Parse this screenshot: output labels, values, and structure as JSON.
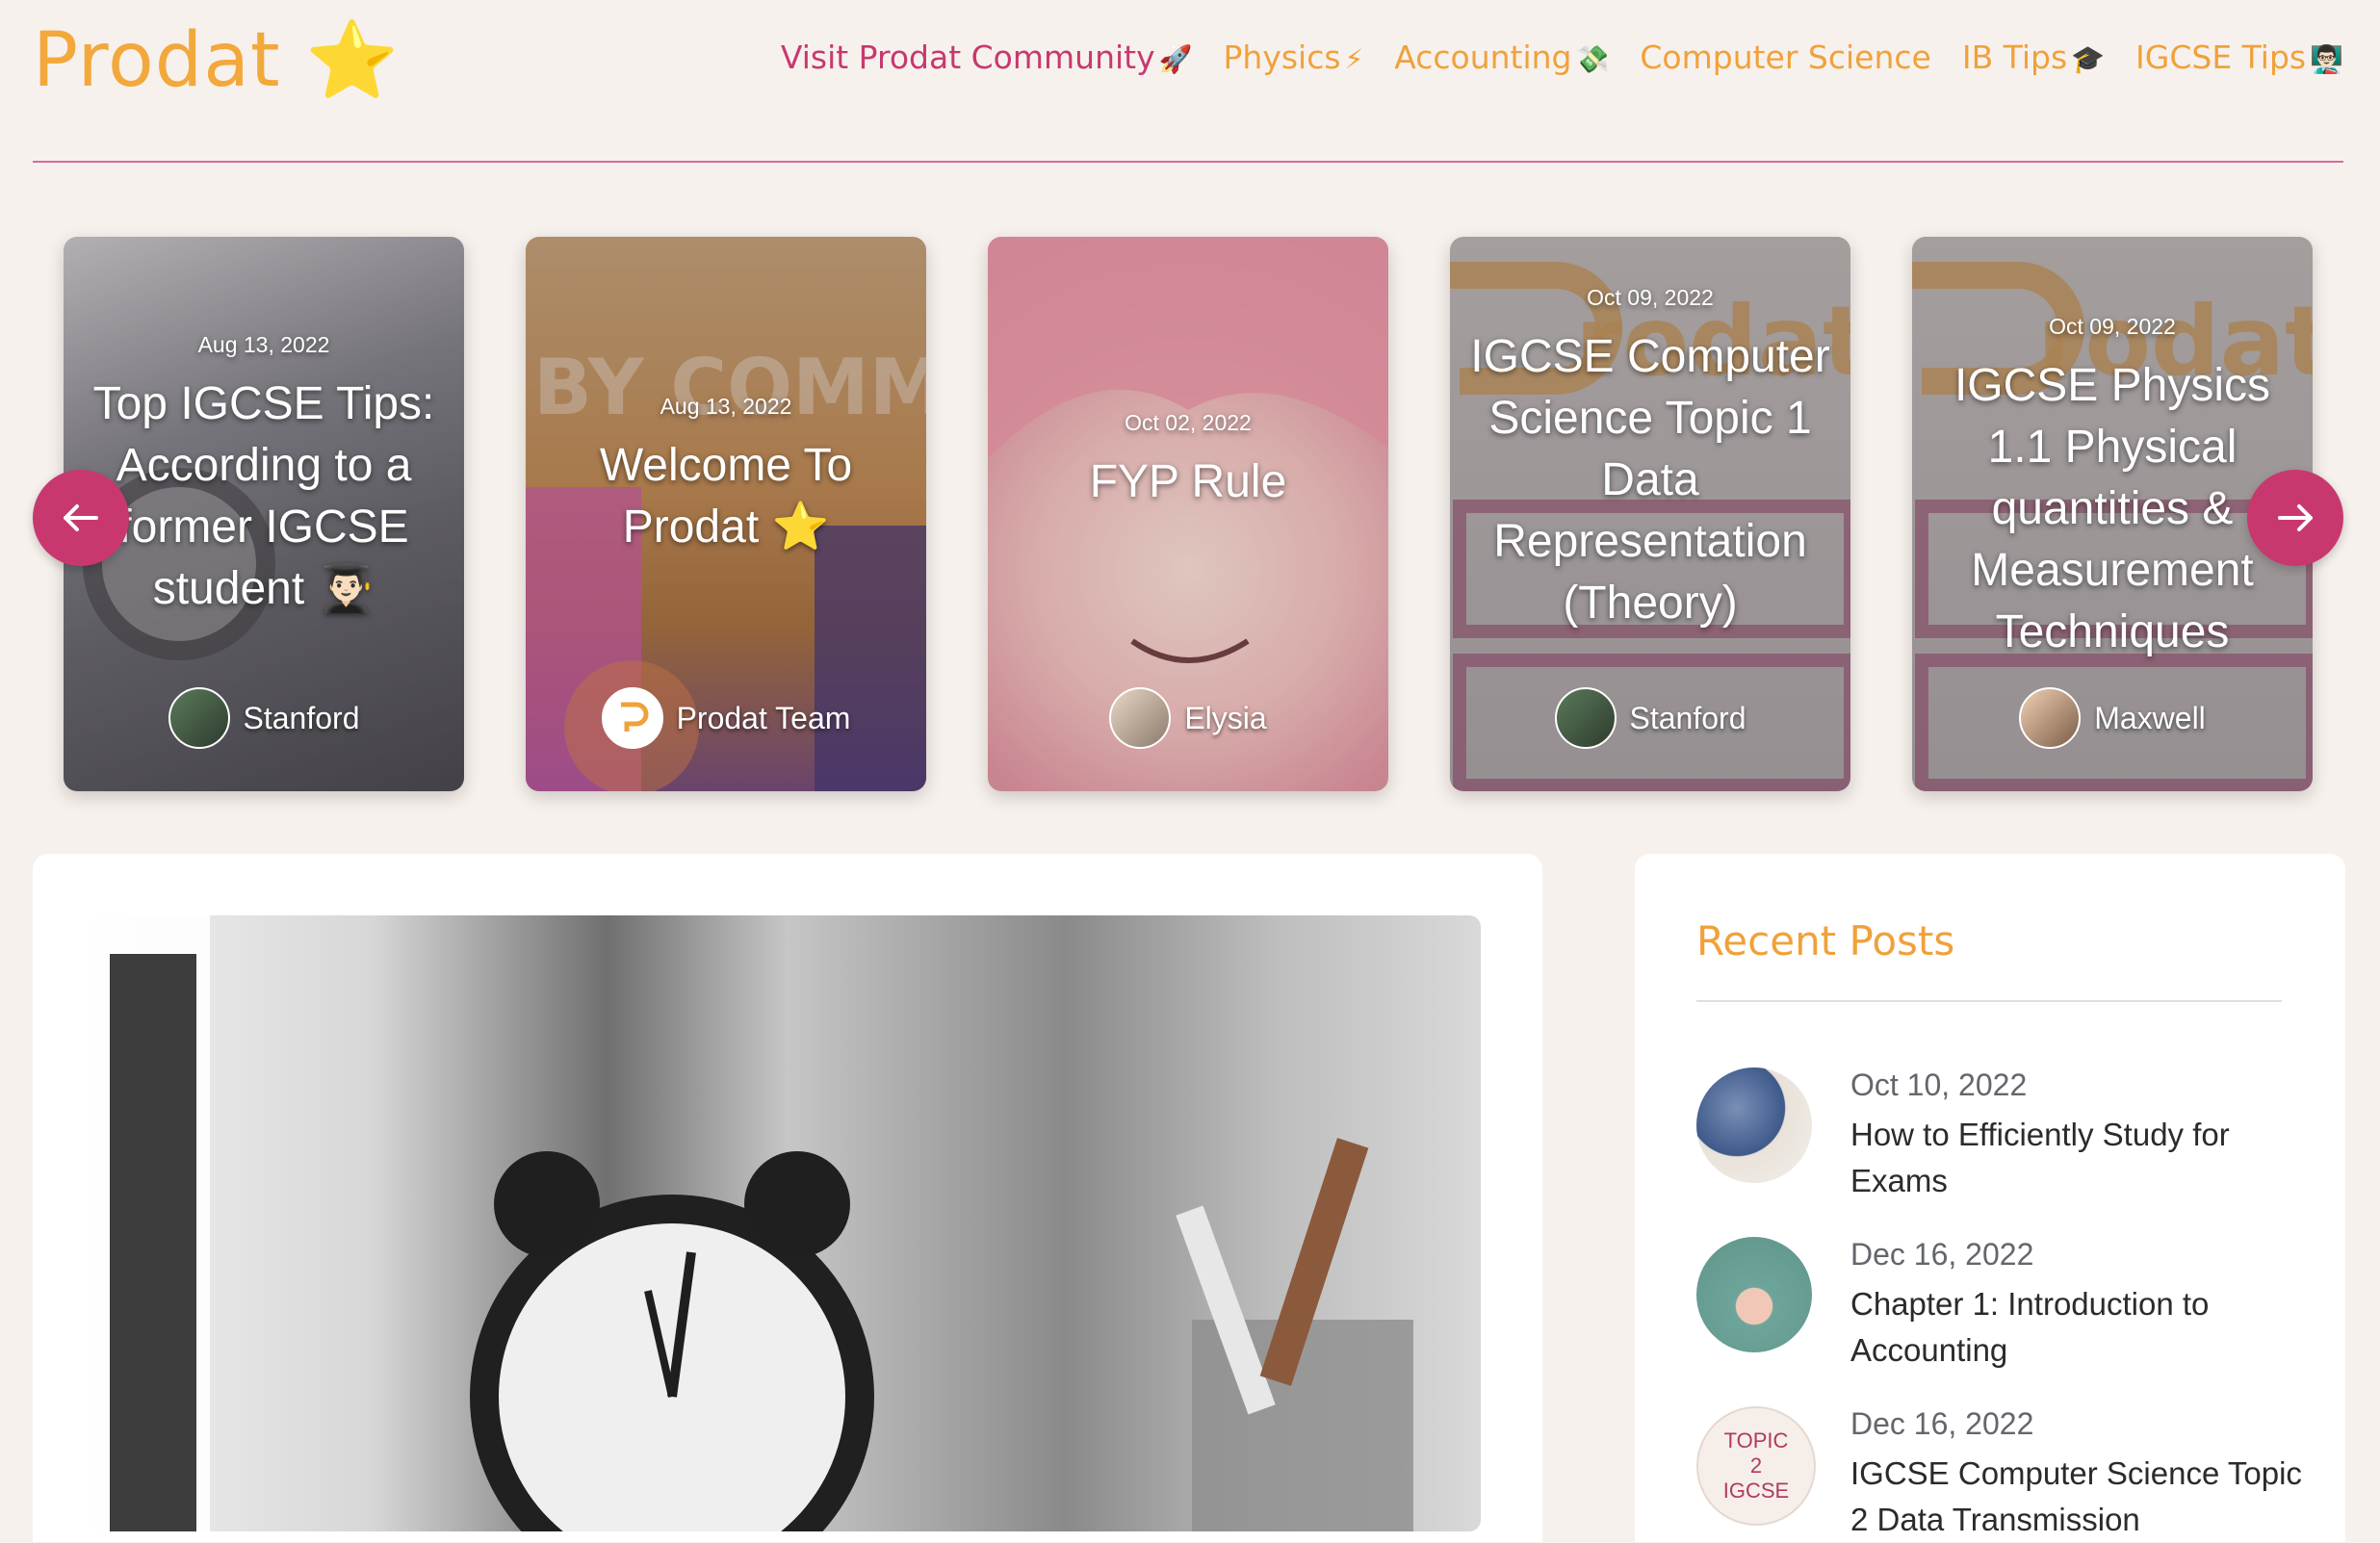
{
  "header": {
    "logo": "Prodat ⭐",
    "nav": [
      {
        "label": "Visit Prodat Community",
        "emoji": "🚀"
      },
      {
        "label": "Physics",
        "emoji": "⚡"
      },
      {
        "label": "Accounting",
        "emoji": "💸"
      },
      {
        "label": "Computer Science",
        "emoji": ""
      },
      {
        "label": "IB Tips",
        "emoji": "🎓"
      },
      {
        "label": "IGCSE Tips",
        "emoji": "👨🏻‍🏫"
      }
    ]
  },
  "carousel": {
    "cards": [
      {
        "date": "Aug 13, 2022",
        "title": "Top IGCSE Tips: According to a former IGCSE student 👨🏻‍🎓",
        "author": "Stanford"
      },
      {
        "date": "Aug 13, 2022",
        "title": "Welcome To Prodat ⭐",
        "author": "Prodat Team",
        "bg_text": "BY COMM"
      },
      {
        "date": "Oct 02, 2022",
        "title": "FYP Rule",
        "author": "Elysia"
      },
      {
        "date": "Oct 09, 2022",
        "title": "IGCSE Computer Science Topic 1 Data Representation (Theory)",
        "author": "Stanford",
        "bg_text": "rodat"
      },
      {
        "date": "Oct 09, 2022",
        "title": "IGCSE Physics 1.1 Physical quantities & Measurement Techniques",
        "author": "Maxwell",
        "bg_text": "rodat"
      }
    ]
  },
  "sidebar": {
    "title": "Recent Posts",
    "posts": [
      {
        "date": "Oct 10, 2022",
        "title": "How to Efficiently Study for Exams"
      },
      {
        "date": "Dec 16, 2022",
        "title": "Chapter 1: Introduction to Accounting"
      },
      {
        "date": "Dec 16, 2022",
        "title": "IGCSE Computer Science Topic 2 Data Transmission",
        "thumb_text": "TOPIC 2 IGCSE"
      }
    ]
  },
  "colors": {
    "accent_orange": "#f0a13a",
    "accent_pink": "#c8386f",
    "background": "#f7f1ed"
  }
}
